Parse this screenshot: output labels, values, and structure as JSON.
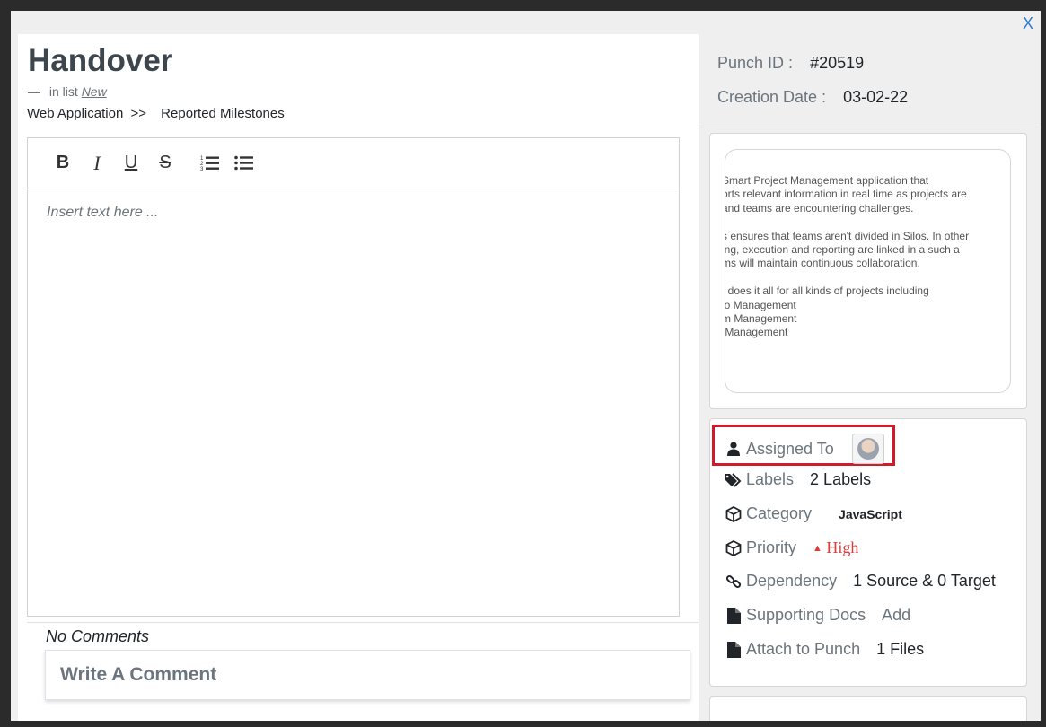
{
  "modal": {
    "close_label": "X"
  },
  "task": {
    "title": "Handover",
    "in_list_prefix": "in list",
    "in_list_name": "New",
    "breadcrumb_project": "Web Application",
    "breadcrumb_sep": ">>",
    "breadcrumb_list": "Reported Milestones"
  },
  "editor": {
    "toolbar": [
      "B",
      "I",
      "U",
      "S"
    ],
    "placeholder": "Insert text here ..."
  },
  "comments": {
    "status": "No Comments",
    "input_placeholder": "Write A Comment"
  },
  "meta": {
    "punch_id_label": "Punch ID :",
    "punch_id": "#20519",
    "creation_date_label": "Creation Date :",
    "creation_date": "03-02-22"
  },
  "preview_text": "Smart Project Management application that\norts relevant information in real time as projects are\nand teams are encountering challenges.\n\ns ensures that teams aren't divided in Silos. In other\ning, execution and reporting are linked in a such a\nms will maintain continuous collaboration.\n\nt does it all for all kinds of projects including\nio Management\nm Management\n Management",
  "details": {
    "assigned_to_label": "Assigned To",
    "labels_label": "Labels",
    "labels_value": "2 Labels",
    "category_label": "Category",
    "category_value": "JavaScript",
    "priority_label": "Priority",
    "priority_value": "High",
    "dependency_label": "Dependency",
    "dependency_value": "1 Source & 0 Target",
    "supporting_docs_label": "Supporting Docs",
    "supporting_docs_value": "Add",
    "attach_label": "Attach to Punch",
    "attach_value": "1 Files"
  },
  "colors": {
    "accent": "#2a7ad6",
    "priority_high": "#e03b3b",
    "highlight": "#d11a2a"
  }
}
